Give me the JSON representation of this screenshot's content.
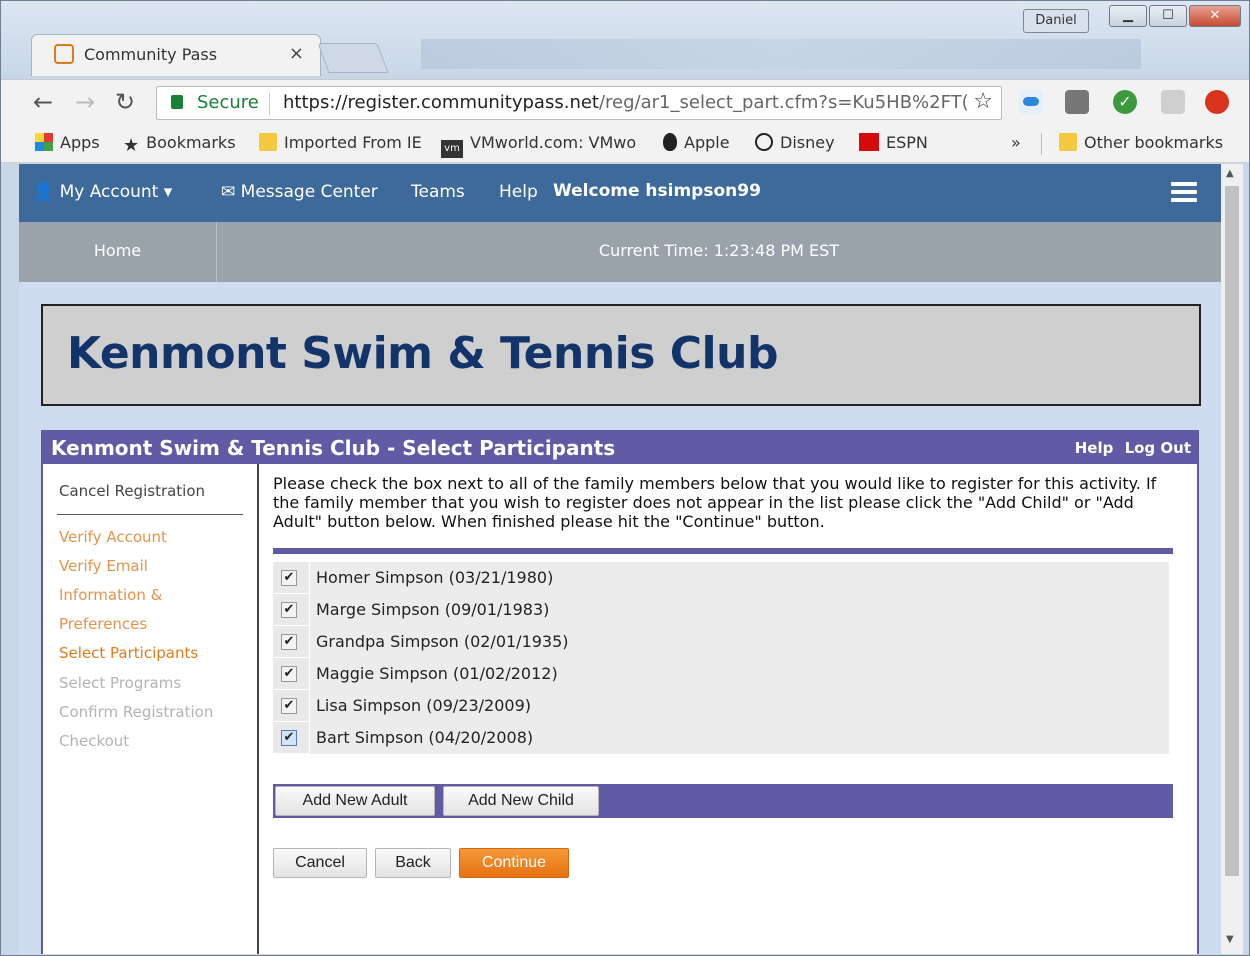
{
  "browser": {
    "tab_title": "Community Pass",
    "tab_close": "×",
    "user_chip": "Daniel",
    "win_min": "▁",
    "win_max": "☐",
    "win_close": "✕",
    "secure_label": "Secure",
    "url_host": "https://register.communitypass.net",
    "url_path": "/reg/ar1_select_part.cfm?s=Ku5HB%2FT(",
    "bookmarks": [
      {
        "label": "Apps",
        "icon": "apps-grid-icon"
      },
      {
        "label": "Bookmarks",
        "icon": "star-icon"
      },
      {
        "label": "Imported From IE",
        "icon": "folder-icon"
      },
      {
        "label": "VMworld.com: VMwo",
        "icon": "vm-icon"
      },
      {
        "label": "Apple",
        "icon": "apple-icon"
      },
      {
        "label": "Disney",
        "icon": "disney-icon"
      },
      {
        "label": "ESPN",
        "icon": "espn-icon"
      }
    ],
    "overflow": "»",
    "other_bookmarks": "Other bookmarks"
  },
  "site": {
    "my_account": "My Account",
    "message_center": "Message Center",
    "teams": "Teams",
    "help": "Help",
    "welcome": "Welcome hsimpson99",
    "home": "Home",
    "current_time": "Current Time: 1:23:48 PM EST",
    "club_name": "Kenmont Swim & Tennis Club"
  },
  "panel": {
    "title": "Kenmont Swim & Tennis Club - Select Participants",
    "help_link": "Help",
    "logout_link": "Log Out",
    "cancel_registration": "Cancel Registration",
    "steps": [
      {
        "label": "Verify Account",
        "state": "done"
      },
      {
        "label": "Verify Email",
        "state": "done"
      },
      {
        "label": "Information &",
        "state": "done"
      },
      {
        "label": "Preferences",
        "state": "done"
      },
      {
        "label": "Select Participants",
        "state": "current"
      },
      {
        "label": "Select Programs",
        "state": "pending"
      },
      {
        "label": "Confirm Registration",
        "state": "pending"
      },
      {
        "label": "Checkout",
        "state": "pending"
      }
    ],
    "instructions": "Please check the box next to all of the family members below that you would like to register for this activity. If the family member that you wish to register does not appear in the list please click the \"Add Child\" or \"Add Adult\" button below. When finished please hit the \"Continue\" button.",
    "participants": [
      {
        "name": "Homer Simpson (03/21/1980)",
        "checked": true
      },
      {
        "name": "Marge Simpson (09/01/1983)",
        "checked": true
      },
      {
        "name": "Grandpa Simpson (02/01/1935)",
        "checked": true
      },
      {
        "name": "Maggie Simpson (01/02/2012)",
        "checked": true
      },
      {
        "name": "Lisa Simpson (09/23/2009)",
        "checked": true
      },
      {
        "name": "Bart Simpson (04/20/2008)",
        "checked": true
      }
    ],
    "add_adult": "Add New Adult",
    "add_child": "Add New Child",
    "cancel": "Cancel",
    "back": "Back",
    "continue": "Continue"
  }
}
